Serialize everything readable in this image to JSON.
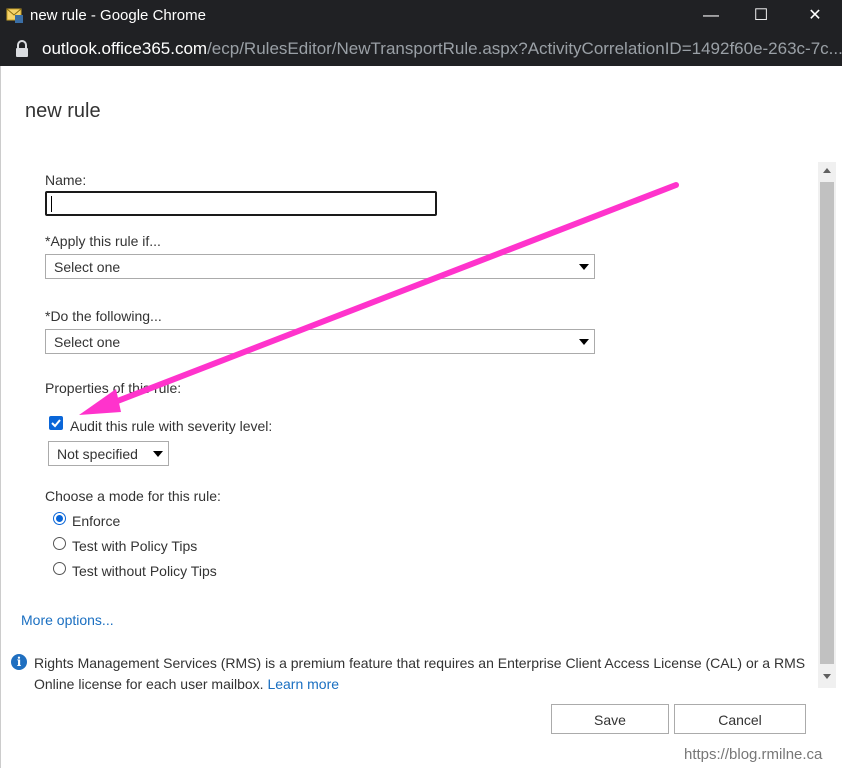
{
  "window": {
    "title": "new rule - Google Chrome",
    "controls": {
      "minimize": "—",
      "maximize": "☐",
      "close": "✕"
    }
  },
  "address_bar": {
    "host": "outlook.office365.com",
    "path": "/ecp/RulesEditor/NewTransportRule.aspx?ActivityCorrelationID=1492f60e-263c-7c..."
  },
  "page": {
    "title": "new rule"
  },
  "form": {
    "name": {
      "label": "Name:",
      "value": ""
    },
    "apply_if": {
      "label": "*Apply this rule if...",
      "selected": "Select one"
    },
    "do_following": {
      "label": "*Do the following...",
      "selected": "Select one"
    },
    "properties": {
      "label": "Properties of this rule:",
      "audit": {
        "label": "Audit this rule with severity level:",
        "checked": true
      },
      "severity": {
        "selected": "Not specified"
      }
    },
    "mode": {
      "label": "Choose a mode for this rule:",
      "options": [
        {
          "label": "Enforce",
          "checked": true
        },
        {
          "label": "Test with Policy Tips",
          "checked": false
        },
        {
          "label": "Test without Policy Tips",
          "checked": false
        }
      ]
    },
    "more_options": "More options..."
  },
  "info": {
    "text": "Rights Management Services (RMS) is a premium feature that requires an Enterprise Client Access License (CAL) or a RMS Online license for each user mailbox. ",
    "link": "Learn more"
  },
  "buttons": {
    "save": "Save",
    "cancel": "Cancel"
  },
  "watermark": "https://blog.rmilne.ca",
  "colors": {
    "accent": "#0a66d8",
    "annotation_arrow": "#ff33cc",
    "link": "#1a6fc1"
  }
}
